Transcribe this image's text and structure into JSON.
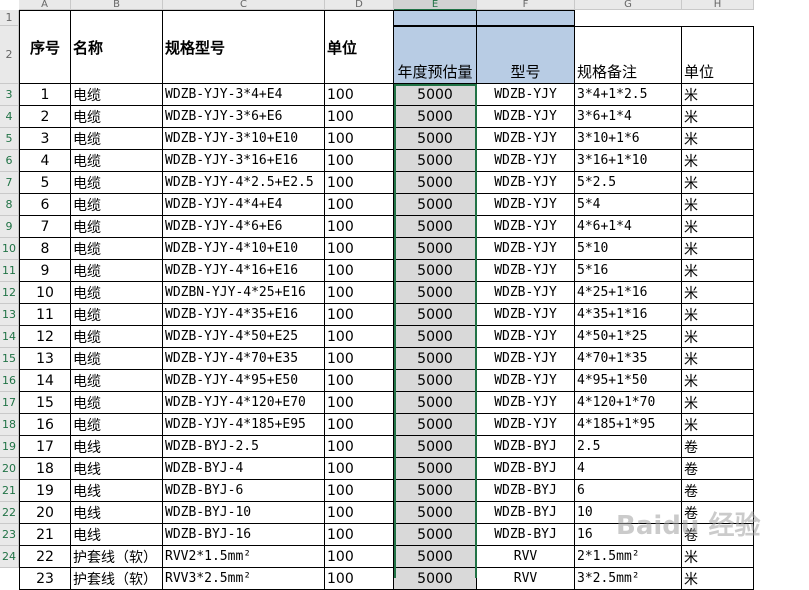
{
  "columns": [
    "A",
    "B",
    "C",
    "D",
    "E",
    "F",
    "G",
    "H"
  ],
  "row_numbers": [
    "1",
    "2",
    "3",
    "4",
    "5",
    "6",
    "7",
    "8",
    "9",
    "10",
    "11",
    "12",
    "13",
    "14",
    "15",
    "16",
    "17",
    "18",
    "19",
    "20",
    "21",
    "22",
    "23",
    "24"
  ],
  "header_left": {
    "seq": "序号",
    "name": "名称",
    "spec": "规格型号",
    "unit": "单位"
  },
  "header_right": {
    "annual": "年度预估量",
    "model": "型号",
    "spec_note": "规格备注",
    "unit": "单位"
  },
  "rows": [
    {
      "seq": "1",
      "name": "电缆",
      "spec": "WDZB-YJY-3*4+E4",
      "unit": "100",
      "annual": "5000",
      "model": "WDZB-YJY",
      "note": "3*4+1*2.5",
      "u2": "米"
    },
    {
      "seq": "2",
      "name": "电缆",
      "spec": "WDZB-YJY-3*6+E6",
      "unit": "100",
      "annual": "5000",
      "model": "WDZB-YJY",
      "note": "3*6+1*4",
      "u2": "米"
    },
    {
      "seq": "3",
      "name": "电缆",
      "spec": "WDZB-YJY-3*10+E10",
      "unit": "100",
      "annual": "5000",
      "model": "WDZB-YJY",
      "note": "3*10+1*6",
      "u2": "米"
    },
    {
      "seq": "4",
      "name": "电缆",
      "spec": "WDZB-YJY-3*16+E16",
      "unit": "100",
      "annual": "5000",
      "model": "WDZB-YJY",
      "note": "3*16+1*10",
      "u2": "米"
    },
    {
      "seq": "5",
      "name": "电缆",
      "spec": "WDZB-YJY-4*2.5+E2.5",
      "unit": "100",
      "annual": "5000",
      "model": "WDZB-YJY",
      "note": "5*2.5",
      "u2": "米"
    },
    {
      "seq": "6",
      "name": "电缆",
      "spec": "WDZB-YJY-4*4+E4",
      "unit": "100",
      "annual": "5000",
      "model": "WDZB-YJY",
      "note": "5*4",
      "u2": "米"
    },
    {
      "seq": "7",
      "name": "电缆",
      "spec": "WDZB-YJY-4*6+E6",
      "unit": "100",
      "annual": "5000",
      "model": "WDZB-YJY",
      "note": "4*6+1*4",
      "u2": "米"
    },
    {
      "seq": "8",
      "name": "电缆",
      "spec": "WDZB-YJY-4*10+E10",
      "unit": "100",
      "annual": "5000",
      "model": "WDZB-YJY",
      "note": "5*10",
      "u2": "米"
    },
    {
      "seq": "9",
      "name": "电缆",
      "spec": "WDZB-YJY-4*16+E16",
      "unit": "100",
      "annual": "5000",
      "model": "WDZB-YJY",
      "note": "5*16",
      "u2": "米"
    },
    {
      "seq": "10",
      "name": "电缆",
      "spec": "WDZBN-YJY-4*25+E16",
      "unit": "100",
      "annual": "5000",
      "model": "WDZB-YJY",
      "note": "4*25+1*16",
      "u2": "米"
    },
    {
      "seq": "11",
      "name": "电缆",
      "spec": "WDZB-YJY-4*35+E16",
      "unit": "100",
      "annual": "5000",
      "model": "WDZB-YJY",
      "note": "4*35+1*16",
      "u2": "米"
    },
    {
      "seq": "12",
      "name": "电缆",
      "spec": "WDZB-YJY-4*50+E25",
      "unit": "100",
      "annual": "5000",
      "model": "WDZB-YJY",
      "note": "4*50+1*25",
      "u2": "米"
    },
    {
      "seq": "13",
      "name": "电缆",
      "spec": "WDZB-YJY-4*70+E35",
      "unit": "100",
      "annual": "5000",
      "model": "WDZB-YJY",
      "note": "4*70+1*35",
      "u2": "米"
    },
    {
      "seq": "14",
      "name": "电缆",
      "spec": "WDZB-YJY-4*95+E50",
      "unit": "100",
      "annual": "5000",
      "model": "WDZB-YJY",
      "note": "4*95+1*50",
      "u2": "米"
    },
    {
      "seq": "15",
      "name": "电缆",
      "spec": "WDZB-YJY-4*120+E70",
      "unit": "100",
      "annual": "5000",
      "model": "WDZB-YJY",
      "note": "4*120+1*70",
      "u2": "米"
    },
    {
      "seq": "16",
      "name": "电缆",
      "spec": "WDZB-YJY-4*185+E95",
      "unit": "100",
      "annual": "5000",
      "model": "WDZB-YJY",
      "note": "4*185+1*95",
      "u2": "米"
    },
    {
      "seq": "17",
      "name": "电线",
      "spec": "WDZB-BYJ-2.5",
      "unit": "100",
      "annual": "5000",
      "model": "WDZB-BYJ",
      "note": "2.5",
      "u2": "卷"
    },
    {
      "seq": "18",
      "name": "电线",
      "spec": "WDZB-BYJ-4",
      "unit": "100",
      "annual": "5000",
      "model": "WDZB-BYJ",
      "note": "4",
      "u2": "卷"
    },
    {
      "seq": "19",
      "name": "电线",
      "spec": "WDZB-BYJ-6",
      "unit": "100",
      "annual": "5000",
      "model": "WDZB-BYJ",
      "note": "6",
      "u2": "卷"
    },
    {
      "seq": "20",
      "name": "电线",
      "spec": "WDZB-BYJ-10",
      "unit": "100",
      "annual": "5000",
      "model": "WDZB-BYJ",
      "note": "10",
      "u2": "卷"
    },
    {
      "seq": "21",
      "name": "电线",
      "spec": "WDZB-BYJ-16",
      "unit": "100",
      "annual": "5000",
      "model": "WDZB-BYJ",
      "note": "16",
      "u2": "卷"
    },
    {
      "seq": "22",
      "name": "护套线（软）",
      "spec": "RVV2*1.5mm²",
      "unit": "100",
      "annual": "5000",
      "model": "RVV",
      "note": "2*1.5mm²",
      "u2": "米"
    },
    {
      "seq": "23",
      "name": "护套线（软）",
      "spec": "RVV3*2.5mm²",
      "unit": "100",
      "annual": "5000",
      "model": "RVV",
      "note": "3*2.5mm²",
      "u2": "米"
    }
  ],
  "watermark": "Baidu 经验"
}
